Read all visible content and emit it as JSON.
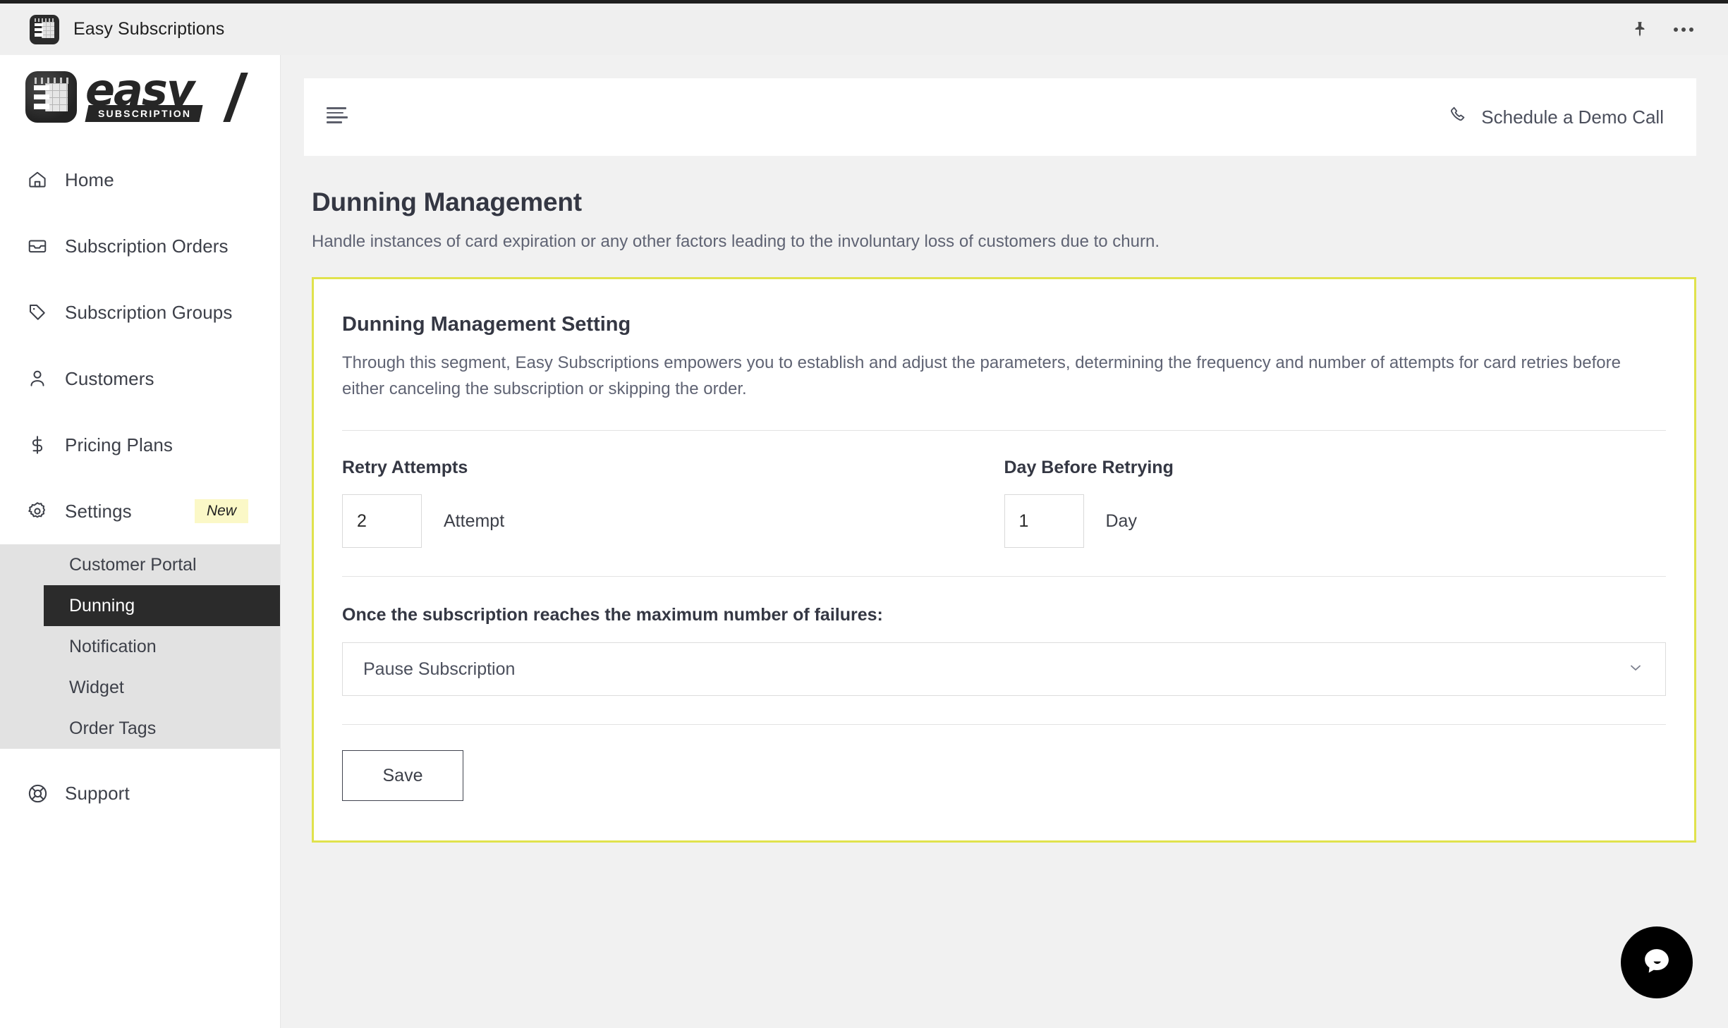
{
  "window": {
    "app_title": "Easy Subscriptions",
    "app_icon": "calendar-app-icon",
    "pin_icon": "pin-icon",
    "more_icon": "more-horizontal-icon"
  },
  "sidebar": {
    "logo": {
      "word": "easy",
      "sub": "SUBSCRIPTION"
    },
    "items": [
      {
        "label": "Home",
        "icon": "home-icon"
      },
      {
        "label": "Subscription Orders",
        "icon": "inbox-icon"
      },
      {
        "label": "Subscription Groups",
        "icon": "tag-icon"
      },
      {
        "label": "Customers",
        "icon": "person-icon"
      },
      {
        "label": "Pricing Plans",
        "icon": "dollar-icon"
      },
      {
        "label": "Settings",
        "icon": "gear-icon",
        "badge": "New"
      },
      {
        "label": "Support",
        "icon": "lifebuoy-icon"
      }
    ],
    "submenu": [
      {
        "label": "Customer Portal",
        "active": false
      },
      {
        "label": "Dunning",
        "active": true
      },
      {
        "label": "Notification",
        "active": false
      },
      {
        "label": "Widget",
        "active": false
      },
      {
        "label": "Order Tags",
        "active": false
      }
    ]
  },
  "topbar": {
    "menu_icon": "hamburger-menu-icon",
    "demo_call_label": "Schedule a Demo Call",
    "phone_icon": "phone-icon"
  },
  "page": {
    "title": "Dunning Management",
    "subtitle": "Handle instances of card expiration or any other factors leading to the involuntary loss of customers due to churn."
  },
  "card": {
    "accent_color": "#e0e24d",
    "title": "Dunning Management Setting",
    "description": "Through this segment, Easy Subscriptions empowers you to establish and adjust the parameters, determining the frequency and number of attempts for card retries before either canceling the subscription or skipping the order.",
    "retry_attempts": {
      "label": "Retry Attempts",
      "value": "2",
      "unit": "Attempt"
    },
    "day_before_retrying": {
      "label": "Day Before Retrying",
      "value": "1",
      "unit": "Day"
    },
    "max_failures": {
      "label": "Once the subscription reaches the maximum number of failures:",
      "selected": "Pause Subscription",
      "caret_icon": "chevron-down-icon"
    },
    "save_label": "Save"
  },
  "chat": {
    "icon": "chat-bubble-icon"
  }
}
